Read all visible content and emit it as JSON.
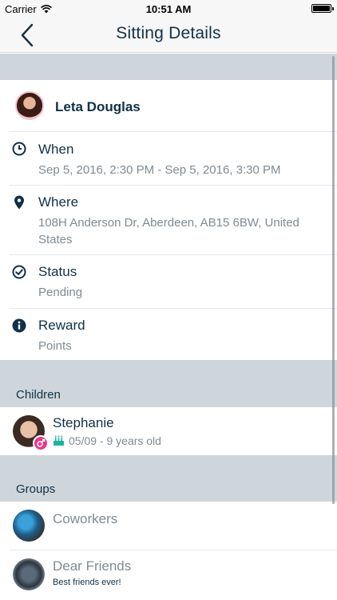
{
  "status_bar": {
    "carrier": "Carrier",
    "time": "10:51 AM"
  },
  "nav": {
    "title": "Sitting Details",
    "back_icon": "chevron-left-icon"
  },
  "sitter": {
    "name": "Leta Douglas"
  },
  "details": {
    "when": {
      "label": "When",
      "value": "Sep 5, 2016, 2:30 PM - Sep 5, 2016, 3:30 PM",
      "icon": "clock-icon"
    },
    "where": {
      "label": "Where",
      "value": "108H Anderson Dr, Aberdeen, AB15 6BW, United States",
      "icon": "map-pin-icon"
    },
    "status": {
      "label": "Status",
      "value": "Pending",
      "icon": "check-circle-icon"
    },
    "reward": {
      "label": "Reward",
      "value": "Points",
      "icon": "info-circle-icon"
    }
  },
  "children": {
    "section_title": "Children",
    "items": [
      {
        "name": "Stephanie",
        "meta": "05/09 - 9 years old",
        "gender_icon": "female-icon",
        "cake_icon": "birthday-cake-icon"
      }
    ]
  },
  "groups": {
    "section_title": "Groups",
    "items": [
      {
        "name": "Coworkers",
        "description": ""
      },
      {
        "name": "Dear Friends",
        "description": "Best friends ever!"
      }
    ]
  },
  "colors": {
    "primary_text": "#123046",
    "secondary_text": "#7f8b93",
    "section_bg": "#cfd6db",
    "accent_pink": "#e8388a",
    "teal": "#21b3a2"
  }
}
